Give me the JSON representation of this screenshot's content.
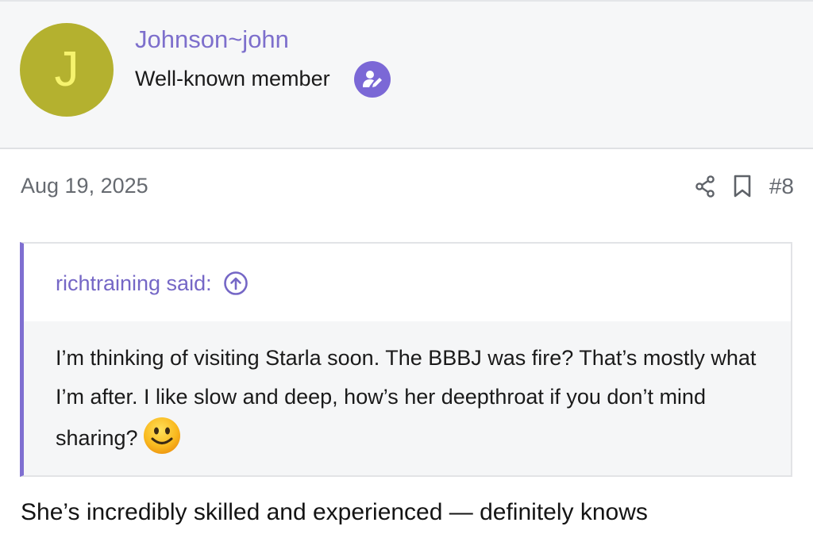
{
  "user": {
    "avatar_letter": "J",
    "avatar_color": "#b4b12f",
    "username": "Johnson~john",
    "title": "Well-known member",
    "badge_icon": "user-pen-icon",
    "badge_color": "#7b68d6"
  },
  "post": {
    "date": "Aug 19, 2025",
    "number": "#8",
    "actions": [
      "share-icon",
      "bookmark-icon"
    ]
  },
  "quote": {
    "author_label": "richtraining said:",
    "jump_icon": "arrow-up-circle-icon",
    "text": "I’m thinking of visiting Starla soon. The BBBJ was fire? That’s mostly what I’m after. I like slow and deep, how’s her deepthroat if you don’t mind sharing?",
    "emoji": "smiley-emoji"
  },
  "body_text": "She’s incredibly skilled and experienced — definitely knows",
  "colors": {
    "accent": "#7f6fd1",
    "header_bg": "#f6f7f8",
    "quote_bg": "#f5f6f7"
  }
}
